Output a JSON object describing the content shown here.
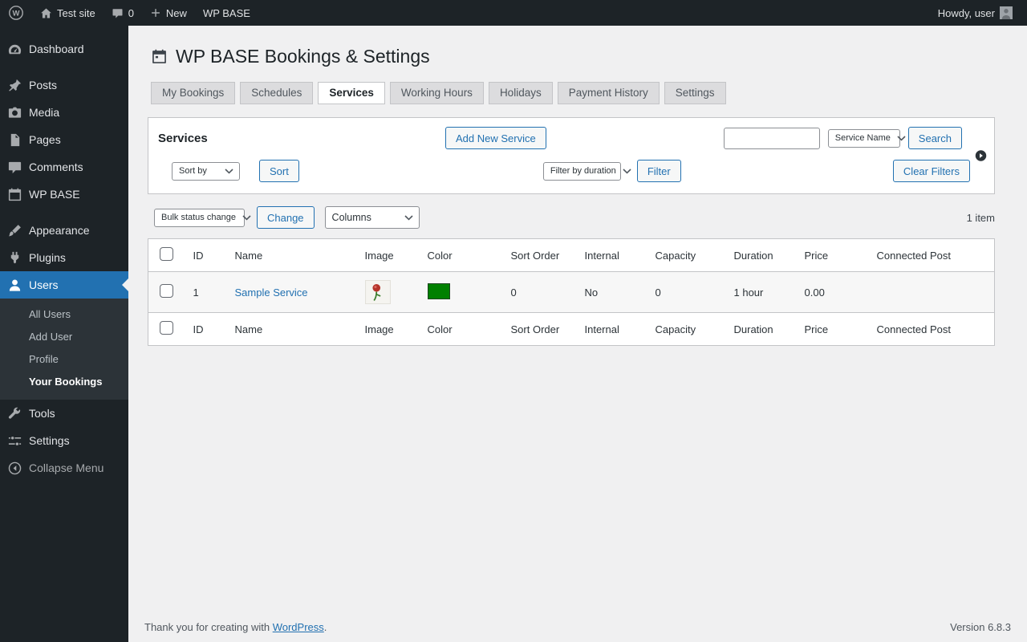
{
  "admin_bar": {
    "site_name": "Test site",
    "comments_count": "0",
    "new_label": "New",
    "plugin_label": "WP BASE",
    "howdy": "Howdy, user"
  },
  "sidebar": {
    "items": [
      {
        "label": "Dashboard",
        "icon": "dashboard-icon"
      },
      {
        "label": "Posts",
        "icon": "pin-icon"
      },
      {
        "label": "Media",
        "icon": "camera-icon"
      },
      {
        "label": "Pages",
        "icon": "pages-icon"
      },
      {
        "label": "Comments",
        "icon": "comment-icon"
      },
      {
        "label": "WP BASE",
        "icon": "calendar-icon"
      },
      {
        "label": "Appearance",
        "icon": "brush-icon"
      },
      {
        "label": "Plugins",
        "icon": "plugin-icon"
      },
      {
        "label": "Users",
        "icon": "users-icon"
      },
      {
        "label": "Tools",
        "icon": "tools-icon"
      },
      {
        "label": "Settings",
        "icon": "settings-icon"
      },
      {
        "label": "Collapse Menu",
        "icon": "collapse-icon"
      }
    ],
    "active_item": "Users",
    "users_submenu": {
      "items": [
        "All Users",
        "Add User",
        "Profile",
        "Your Bookings"
      ],
      "current": "Your Bookings"
    }
  },
  "page": {
    "title": "WP BASE Bookings & Settings",
    "tabs": [
      "My Bookings",
      "Schedules",
      "Services",
      "Working Hours",
      "Holidays",
      "Payment History",
      "Settings"
    ],
    "active_tab": "Services"
  },
  "panel": {
    "heading": "Services",
    "add_new_button": "Add New Service",
    "search_value": "",
    "search_field_select": "Service Name",
    "search_button": "Search",
    "sort_select": "Sort by",
    "sort_button": "Sort",
    "filter_select": "Filter by duration",
    "filter_button": "Filter",
    "clear_filters_button": "Clear Filters"
  },
  "bulk_bar": {
    "bulk_select": "Bulk status change",
    "change_button": "Change",
    "columns_select": "Columns",
    "item_count": "1 item"
  },
  "table": {
    "headers": [
      "ID",
      "Name",
      "Image",
      "Color",
      "Sort Order",
      "Internal",
      "Capacity",
      "Duration",
      "Price",
      "Connected Post"
    ],
    "rows": [
      {
        "id": "1",
        "name": "Sample Service",
        "color": "#008000",
        "sort_order": "0",
        "internal": "No",
        "capacity": "0",
        "duration": "1 hour",
        "price": "0.00",
        "connected_post": ""
      }
    ]
  },
  "footer": {
    "thanks_prefix": "Thank you for creating with ",
    "wordpress_link": "WordPress",
    "thanks_suffix": ".",
    "version": "Version 6.8.3"
  },
  "colors": {
    "accent": "#2271b1",
    "sidebar_bg": "#1d2327",
    "submenu_bg": "#2c3338",
    "page_bg": "#f0f0f1",
    "service_color": "#008000"
  }
}
